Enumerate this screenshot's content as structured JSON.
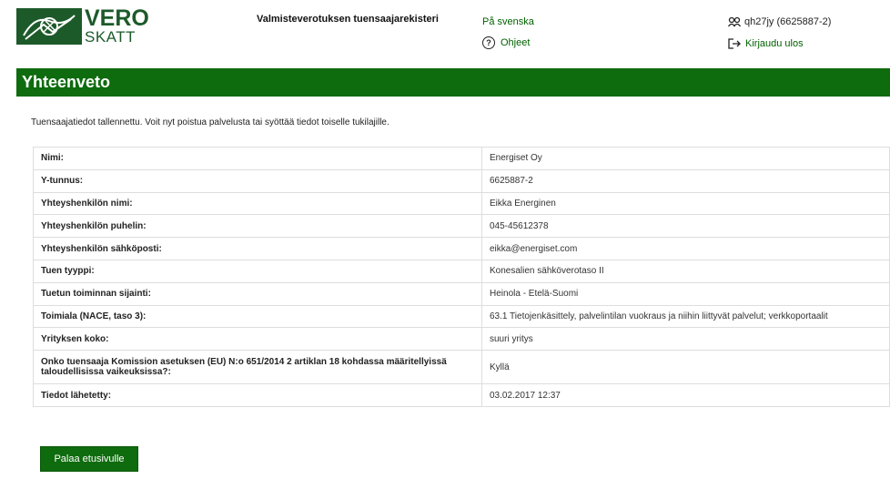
{
  "header": {
    "logo": {
      "line1": "VERO",
      "line2": "SKATT"
    },
    "service_title": "Valmisteverotuksen tuensaajarekisteri",
    "lang_link": "På svenska",
    "help_link": "Ohjeet",
    "user": "qh27jy (6625887-2)",
    "logout": "Kirjaudu ulos"
  },
  "page": {
    "title": "Yhteenveto",
    "notice": "Tuensaajatiedot tallennettu. Voit nyt poistua palvelusta tai syöttää tiedot toiselle tukilajille."
  },
  "summary_rows": [
    {
      "label": "Nimi:",
      "value": "Energiset Oy"
    },
    {
      "label": "Y-tunnus:",
      "value": "6625887-2"
    },
    {
      "label": "Yhteyshenkilön nimi:",
      "value": "Eikka Energinen"
    },
    {
      "label": "Yhteyshenkilön puhelin:",
      "value": "045-45612378"
    },
    {
      "label": "Yhteyshenkilön sähköposti:",
      "value": "eikka@energiset.com"
    },
    {
      "label": "Tuen tyyppi:",
      "value": "Konesalien sähköverotaso II"
    },
    {
      "label": "Tuetun toiminnan sijainti:",
      "value": "Heinola - Etelä-Suomi"
    },
    {
      "label": "Toimiala (NACE, taso 3):",
      "value": "63.1 Tietojenkäsittely, palvelintilan vuokraus ja niihin liittyvät palvelut; verkkoportaalit"
    },
    {
      "label": "Yrityksen koko:",
      "value": "suuri yritys"
    },
    {
      "label": "Onko tuensaaja Komission asetuksen (EU) N:o 651/2014 2 artiklan 18 kohdassa määritellyissä taloudellisissa vaikeuksissa?:",
      "value": "Kyllä"
    },
    {
      "label": "Tiedot lähetetty:",
      "value": "03.02.2017 12:37"
    }
  ],
  "actions": {
    "back_label": "Palaa etusivulle"
  },
  "colors": {
    "brand_green": "#0e6b0e",
    "link_green": "#006100",
    "logo_green": "#1d5a2a"
  }
}
